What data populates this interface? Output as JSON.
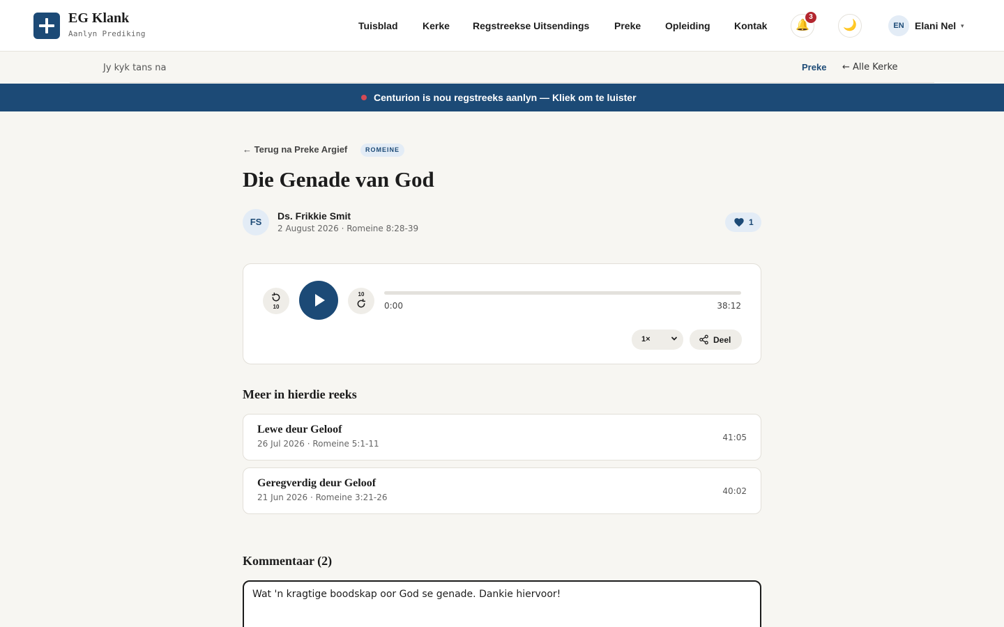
{
  "brand": {
    "name": "EG Klank",
    "subtitle": "Aanlyn Prediking"
  },
  "nav": {
    "items": [
      "Tuisblad",
      "Kerke",
      "Regstreekse Uitsendings",
      "Preke",
      "Opleiding",
      "Kontak"
    ]
  },
  "header": {
    "notifications_count": "3",
    "bell_icon": "🔔",
    "theme_icon": "🌙",
    "user_initials": "EN",
    "user_name": "Elani Nel",
    "user_caret": "▾"
  },
  "subbar": {
    "viewing_label": "Jy kyk tans na",
    "current_link": "Preke",
    "back_label": "← Alle Kerke"
  },
  "live_banner": {
    "text": "Centurion is nou regstreeks aanlyn — Kliek om te luister",
    "dot_color": "#d24a55"
  },
  "sermon": {
    "back_label": "← Terug na Preke Argief",
    "tag": "ROMEINE",
    "title": "Die Genade van God",
    "preacher_initials": "FS",
    "preacher": "Ds. Frikkie Smit",
    "meta": "2 August 2026 · Romeine 8:28-39",
    "likes": "1"
  },
  "player": {
    "rewind_label": "10",
    "forward_label": "10",
    "current_time": "0:00",
    "total_time": "38:12",
    "progress": 0,
    "speed": "1×",
    "share_label": "Deel"
  },
  "series": {
    "heading": "Meer in hierdie reeks",
    "items": [
      {
        "title": "Lewe deur Geloof",
        "meta": "26 Jul 2026 · Romeine 5:1-11",
        "duration": "41:05"
      },
      {
        "title": "Geregverdig deur Geloof",
        "meta": "21 Jun 2026 · Romeine 3:21-26",
        "duration": "40:02"
      }
    ]
  },
  "comments": {
    "heading": "Kommentaar (2)",
    "input_value": "Wat 'n kragtige boodskap oor God se genade. Dankie hiervoor!"
  },
  "colors": {
    "accent": "#1c4a76",
    "background": "#f7f6f2",
    "badge": "#b3262e"
  }
}
